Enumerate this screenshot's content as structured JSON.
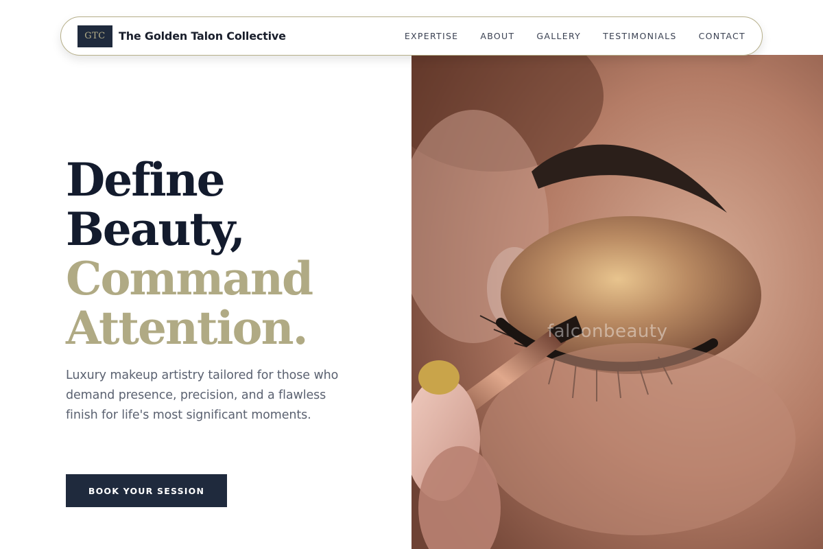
{
  "brand": {
    "logo_text": "GTC",
    "name": "The Golden Talon Collective"
  },
  "nav": {
    "items": [
      {
        "label": "EXPERTISE"
      },
      {
        "label": "ABOUT"
      },
      {
        "label": "GALLERY"
      },
      {
        "label": "TESTIMONIALS"
      },
      {
        "label": "CONTACT"
      }
    ]
  },
  "hero": {
    "headline_line1": "Define",
    "headline_line2": "Beauty,",
    "headline_line3": "Command",
    "headline_line4": "Attention.",
    "description": "Luxury makeup artistry tailored for those who demand presence, precision, and a flawless finish for life's most significant moments.",
    "cta_label": "BOOK YOUR SESSION",
    "image_watermark": "falconbeauty"
  },
  "colors": {
    "navy": "#1f2a3d",
    "gold": "#b0aa84",
    "headline_dark": "#131b2d",
    "body_text": "#5a6170"
  },
  "icons": {
    "hero_photo": "eye-makeup-closeup-photo"
  }
}
